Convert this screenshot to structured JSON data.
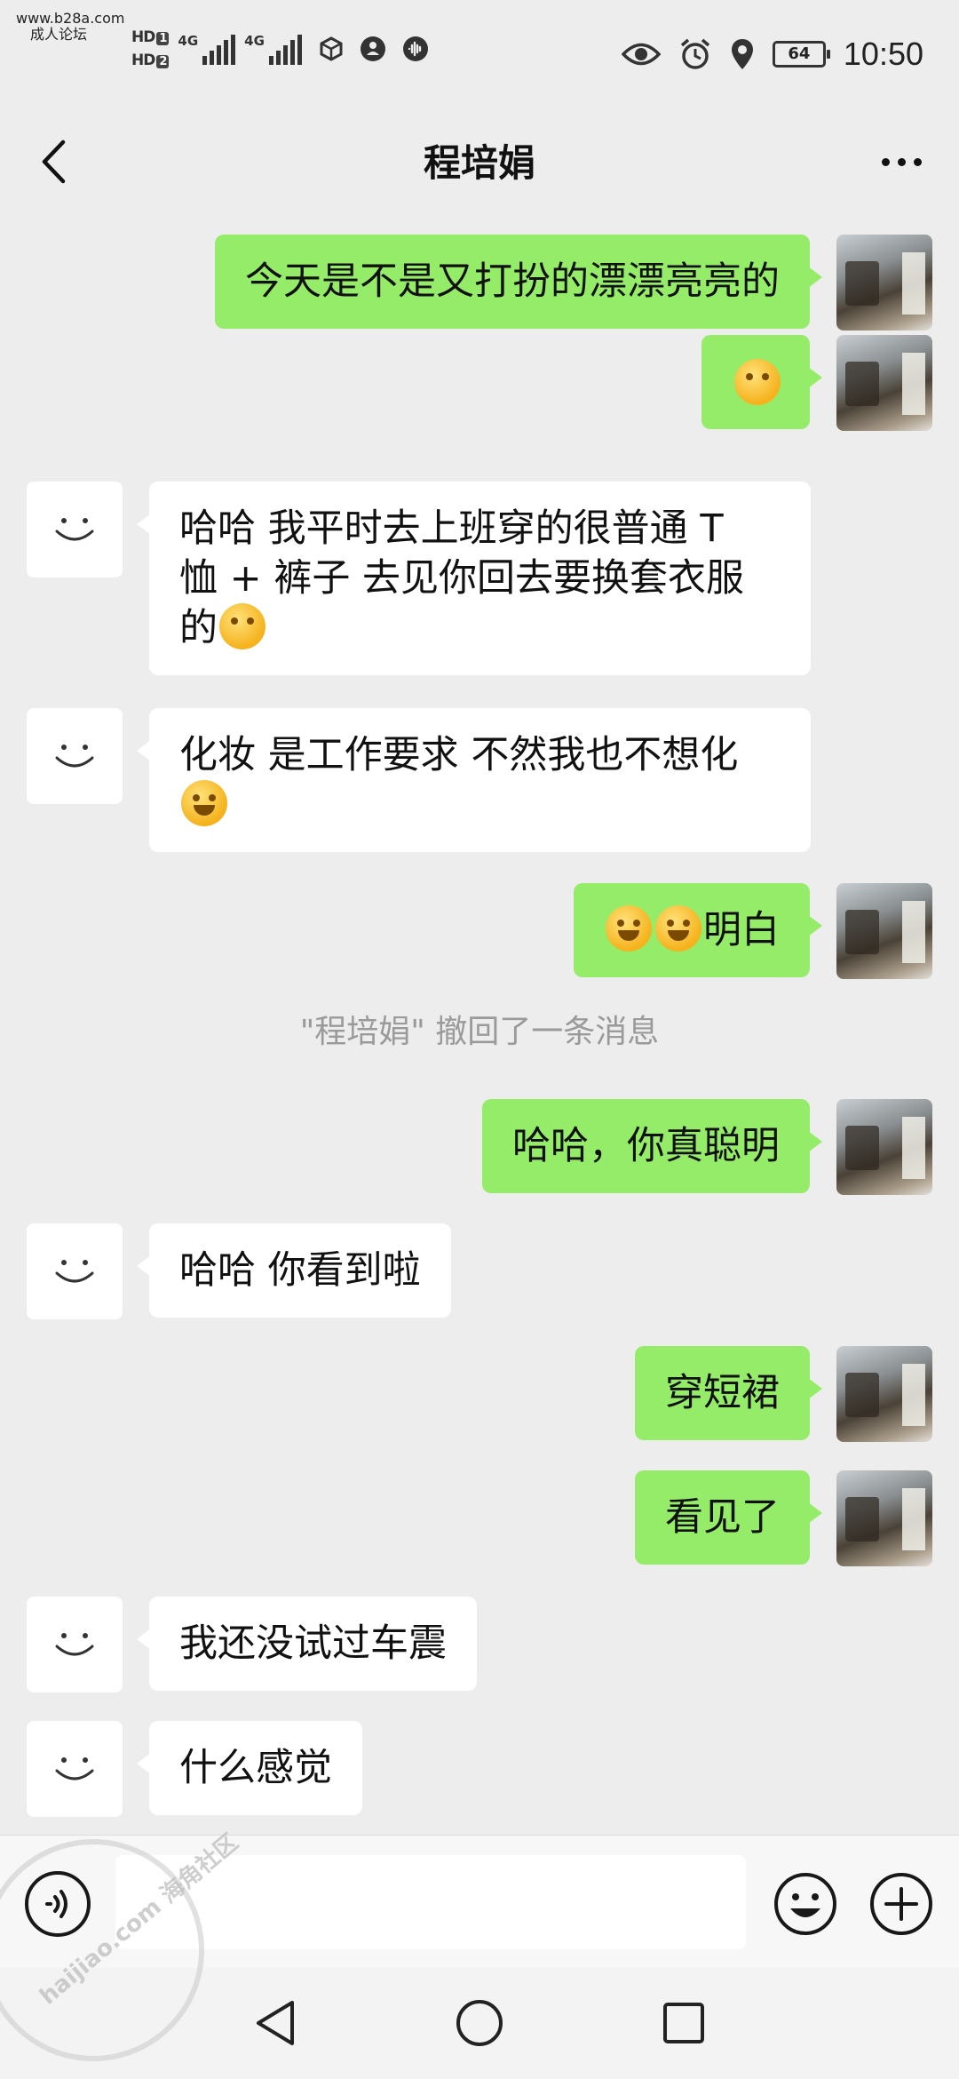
{
  "watermark": {
    "site": "www.b28a.com",
    "label": "成人论坛",
    "stamp": "haijiao.com 海角社区"
  },
  "status_bar": {
    "sim1": "HD",
    "sim1_num": "1",
    "sim2": "HD",
    "sim2_num": "2",
    "net1": "4G",
    "net2": "4G",
    "battery": "64",
    "time": "10:50"
  },
  "header": {
    "title": "程培娟"
  },
  "messages": [
    {
      "side": "me",
      "text": "今天是不是又打扮的漂漂亮亮的"
    },
    {
      "side": "me",
      "text": "",
      "emoji": "thinking-face-emoji"
    },
    {
      "side": "other",
      "line1": "哈哈 我平时去上班穿的很普通 T",
      "line2": "恤 + 裤子 去见你回去要换套衣服",
      "line3": "的",
      "emoji": "thinking-face-emoji"
    },
    {
      "side": "other",
      "line1": "化妆 是工作要求 不然我也不想化",
      "emoji": "tears-of-joy-emoji"
    },
    {
      "side": "me",
      "text": "明白",
      "emoji": "crying-face-emoji"
    },
    {
      "side": "other",
      "text": "哈哈 你看到啦"
    },
    {
      "side": "me",
      "text": "哈哈，你真聪明"
    },
    {
      "side": "me",
      "text": "穿短裙"
    },
    {
      "side": "me",
      "text": "看见了"
    },
    {
      "side": "other",
      "text": "我还没试过车震"
    },
    {
      "side": "other",
      "text": "什么感觉"
    }
  ],
  "recall_notice": "\"程培娟\" 撤回了一条消息",
  "input": {
    "value": "",
    "placeholder": ""
  },
  "icons": {
    "back": "back-chevron-icon",
    "more": "more-dots-icon",
    "voice": "voice-icon",
    "emoji": "emoji-icon",
    "plus": "plus-icon"
  },
  "colors": {
    "bubble_me": "#95ec69",
    "bubble_other": "#ffffff",
    "background": "#ededed"
  }
}
